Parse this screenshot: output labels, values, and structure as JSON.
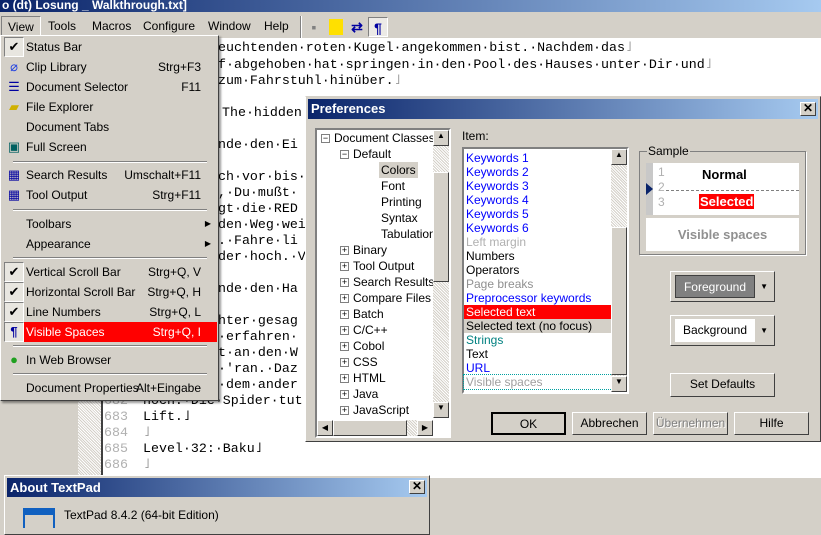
{
  "window": {
    "title": "o (dt) Losung _ Walkthrough.txt]"
  },
  "menubar": {
    "items": [
      "View",
      "Tools",
      "Macros",
      "Configure",
      "Window",
      "Help"
    ]
  },
  "toolbar": {
    "icons": [
      "save-icon",
      "save-all-icon",
      "word-wrap-icon",
      "visible-spaces-icon"
    ],
    "pilcrow": "¶"
  },
  "editor": {
    "lines": [
      {
        "text": "euchtenden·roten·Kugel·angekommen·bist.·Nachdem·das",
        "eol": "˩"
      },
      {
        "text": "f·abgehoben·hat·springen·in·den·Pool·des·Hauses·unter·Dir·und",
        "eol": "˩"
      },
      {
        "text": "zum·Fahrstuhl·hinüber.",
        "eol": "˩"
      },
      {
        "text": "The·hidden"
      },
      {
        "text": "nde·den·Ei"
      },
      {
        "text": "ch·vor·bis·"
      },
      {
        "text": ",·Du·mußt·"
      },
      {
        "text": "gt·die·RED"
      },
      {
        "text": "den·Weg·wei"
      },
      {
        "text": ".·Fahre·li"
      },
      {
        "text": "der·hoch.·V"
      },
      {
        "text": "nde·den·Ha"
      },
      {
        "text": "hter·gesag"
      },
      {
        "text": "·erfahren·"
      },
      {
        "text": "t·an·den·W"
      },
      {
        "text": "·'ran.·Daz"
      },
      {
        "text": "·dem·ander"
      },
      {
        "text": "hoch.·Die·Spider·tut"
      }
    ],
    "numbered": [
      {
        "num": "682",
        "text": ""
      },
      {
        "num": "683",
        "text": "Lift.˩"
      },
      {
        "num": "684",
        "text": "˩"
      },
      {
        "num": "685",
        "text": "Level·32:·Baku˩"
      },
      {
        "num": "686",
        "text": "˩"
      }
    ]
  },
  "view_menu": {
    "items": [
      {
        "label": "Status Bar",
        "shortcut": "",
        "icon": "check-icon",
        "checked": true
      },
      {
        "label": "Clip Library",
        "shortcut": "Strg+F3",
        "icon": "paperclip-icon"
      },
      {
        "label": "Document Selector",
        "shortcut": "F11",
        "icon": "document-selector-icon"
      },
      {
        "label": "File Explorer",
        "shortcut": "",
        "icon": "folder-search-icon"
      },
      {
        "label": "Document Tabs",
        "shortcut": ""
      },
      {
        "label": "Full Screen",
        "shortcut": "",
        "icon": "full-screen-icon"
      },
      {
        "label": "Search Results",
        "shortcut": "Umschalt+F11",
        "icon": "search-results-icon"
      },
      {
        "label": "Tool Output",
        "shortcut": "Strg+F11",
        "icon": "tool-output-icon"
      },
      {
        "label": "Toolbars",
        "submenu": true
      },
      {
        "label": "Appearance",
        "submenu": true
      },
      {
        "label": "Vertical Scroll Bar",
        "shortcut": "Strg+Q, V",
        "checked": true
      },
      {
        "label": "Horizontal Scroll Bar",
        "shortcut": "Strg+Q, H",
        "checked": true
      },
      {
        "label": "Line Numbers",
        "shortcut": "Strg+Q, L",
        "checked": true
      },
      {
        "label": "Visible Spaces",
        "shortcut": "Strg+Q, I",
        "highlighted": true,
        "icon": "pilcrow-icon"
      },
      {
        "label": "In Web Browser",
        "shortcut": "",
        "icon": "globe-icon"
      },
      {
        "label": "Document Properties",
        "shortcut": "Alt+Eingabe"
      }
    ],
    "highlight_color": "#ff0000"
  },
  "preferences": {
    "title": "Preferences",
    "close": "✕",
    "tree": [
      {
        "label": "Document Classes",
        "level": 0,
        "expander": "−"
      },
      {
        "label": "Default",
        "level": 1,
        "expander": "−"
      },
      {
        "label": "Colors",
        "level": 2,
        "selected": true
      },
      {
        "label": "Font",
        "level": 2
      },
      {
        "label": "Printing",
        "level": 2
      },
      {
        "label": "Syntax",
        "level": 2
      },
      {
        "label": "Tabulation",
        "level": 2
      },
      {
        "label": "Binary",
        "level": 1,
        "expander": "+"
      },
      {
        "label": "Tool Output",
        "level": 1,
        "expander": "+"
      },
      {
        "label": "Search Results",
        "level": 1,
        "expander": "+"
      },
      {
        "label": "Compare Files",
        "level": 1,
        "expander": "+"
      },
      {
        "label": "Batch",
        "level": 1,
        "expander": "+"
      },
      {
        "label": "C/C++",
        "level": 1,
        "expander": "+"
      },
      {
        "label": "Cobol",
        "level": 1,
        "expander": "+"
      },
      {
        "label": "CSS",
        "level": 1,
        "expander": "+"
      },
      {
        "label": "HTML",
        "level": 1,
        "expander": "+"
      },
      {
        "label": "Java",
        "level": 1,
        "expander": "+"
      },
      {
        "label": "JavaScript",
        "level": 1,
        "expander": "+"
      }
    ],
    "item_label": "Item:",
    "items": [
      {
        "label": "Keywords 1",
        "color": "#0000ff"
      },
      {
        "label": "Keywords 2",
        "color": "#0000ff"
      },
      {
        "label": "Keywords 3",
        "color": "#0000ff"
      },
      {
        "label": "Keywords 4",
        "color": "#0000ff"
      },
      {
        "label": "Keywords 5",
        "color": "#0000ff"
      },
      {
        "label": "Keywords 6",
        "color": "#0000ff"
      },
      {
        "label": "Left margin",
        "color": "#b0b0b0"
      },
      {
        "label": "Numbers",
        "color": "#000000"
      },
      {
        "label": "Operators",
        "color": "#000000"
      },
      {
        "label": "Page breaks",
        "color": "#909090"
      },
      {
        "label": "Preprocessor keywords",
        "color": "#0000ff"
      },
      {
        "label": "Selected text",
        "color": "#ffffff",
        "bg": "#ff0000"
      },
      {
        "label": "Selected text (no focus)",
        "color": "#000000",
        "bg": "#d4d0c8"
      },
      {
        "label": "Strings",
        "color": "#008080"
      },
      {
        "label": "Text",
        "color": "#000000"
      },
      {
        "label": "URL",
        "color": "#0000ff"
      },
      {
        "label": "Visible spaces",
        "color": "#a0a0a0",
        "focused": true
      }
    ],
    "sample": {
      "label": "Sample",
      "nums": [
        "1",
        "2",
        "3"
      ],
      "normal": "Normal",
      "selected": "Selected",
      "visible_spaces": "Visible spaces"
    },
    "foreground": "Foreground",
    "background": "Background",
    "set_defaults": "Set Defaults",
    "buttons": {
      "ok": "OK",
      "cancel": "Abbrechen",
      "apply": "Übernehmen",
      "help": "Hilfe"
    }
  },
  "about": {
    "title": "About TextPad",
    "close": "✕",
    "version": "TextPad 8.4.2 (64-bit Edition)"
  }
}
